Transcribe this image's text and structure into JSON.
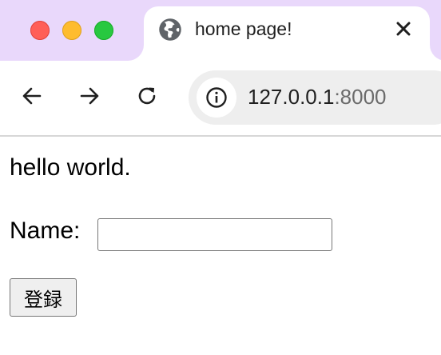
{
  "browser": {
    "tab": {
      "title": "home page!",
      "favicon": "globe-icon"
    },
    "toolbar": {
      "back": "arrow-left-icon",
      "forward": "arrow-right-icon",
      "reload": "reload-icon",
      "site_info": "info-icon"
    },
    "url": {
      "host": "127.0.0.1",
      "port": ":8000"
    }
  },
  "page": {
    "greeting": "hello world.",
    "name_label": "Name:",
    "name_value": "",
    "submit_label": "登録"
  },
  "colors": {
    "tabstrip": "#e9d8fb",
    "traffic_red": "#ff5f57",
    "traffic_yellow": "#febc2e",
    "traffic_green": "#28c840"
  }
}
